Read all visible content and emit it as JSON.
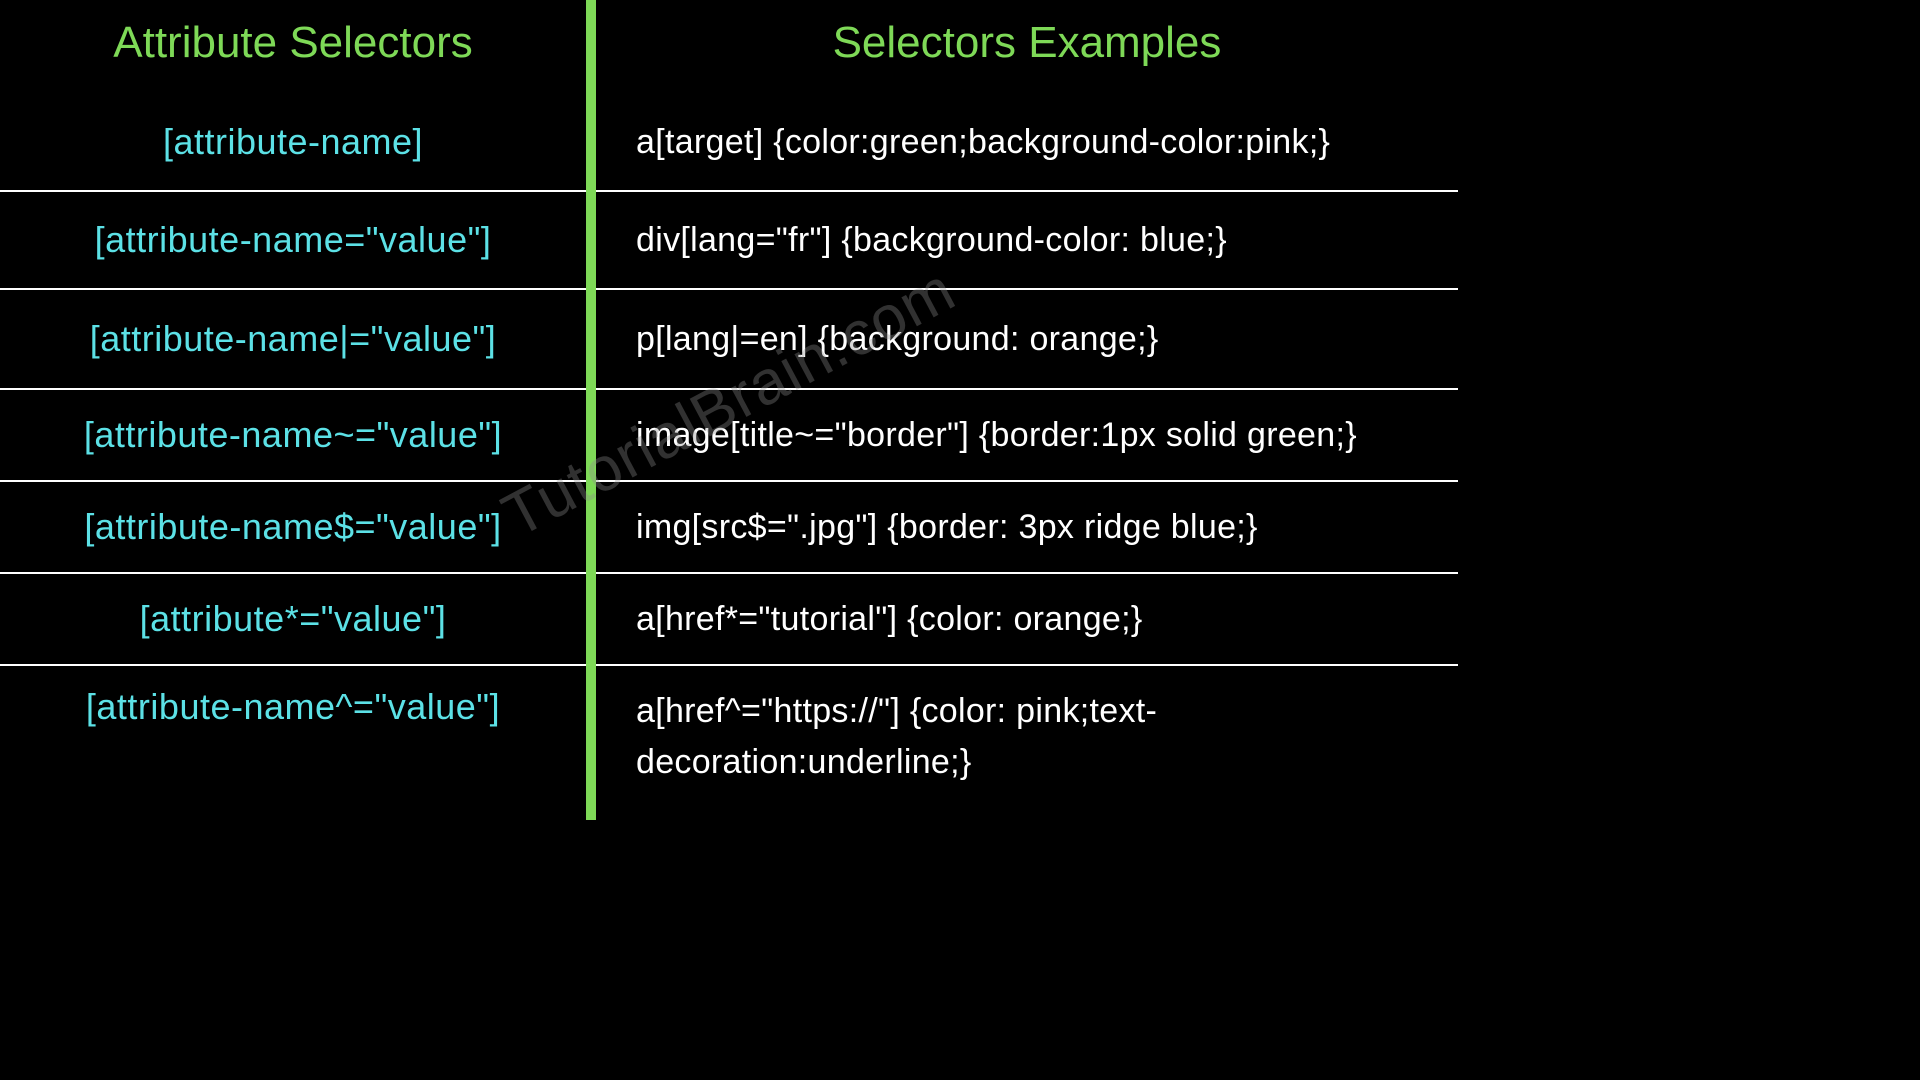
{
  "headers": {
    "left": "Attribute Selectors",
    "right": "Selectors Examples"
  },
  "rows": [
    {
      "selector": "[attribute-name]",
      "example": "a[target] {color:green;background-color:pink;}"
    },
    {
      "selector": "[attribute-name=\"value\"]",
      "example": "div[lang=\"fr\"] {background-color: blue;}"
    },
    {
      "selector": "[attribute-name|=\"value\"]",
      "example": "p[lang|=en] {background: orange;}"
    },
    {
      "selector": "[attribute-name~=\"value\"]",
      "example": "image[title~=\"border\"] {border:1px solid green;}"
    },
    {
      "selector": "[attribute-name$=\"value\"]",
      "example": "img[src$=\".jpg\"] {border: 3px ridge blue;}"
    },
    {
      "selector": "[attribute*=\"value\"]",
      "example": "a[href*=\"tutorial\"] {color: orange;}"
    },
    {
      "selector": "[attribute-name^=\"value\"]",
      "example": "a[href^=\"https://\"] {color: pink;text-decoration:underline;}"
    }
  ],
  "watermark": "TutorialBrain.com"
}
